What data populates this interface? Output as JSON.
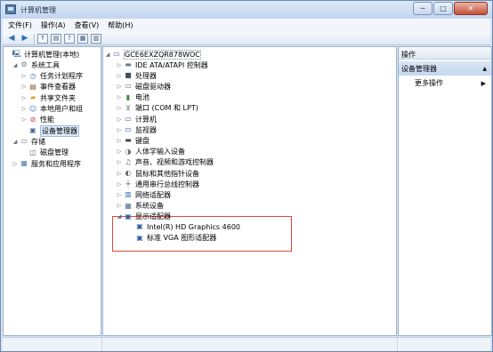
{
  "window": {
    "title": "计算机管理",
    "icon": "computer-management-icon",
    "caption_buttons": [
      "─",
      "□",
      "✕"
    ]
  },
  "menu": [
    "文件(F)",
    "操作(A)",
    "查看(V)",
    "帮助(H)"
  ],
  "toolbar": {
    "buttons": [
      "back-icon",
      "forward-icon",
      "up-folder-icon",
      "show-hide-tree-icon",
      "help-icon",
      "properties-icon",
      "view-icon"
    ]
  },
  "left_tree": [
    {
      "label": "计算机管理(本地)",
      "expander": "",
      "icon": "computer-management-icon"
    },
    {
      "label": "系统工具",
      "expander": "◢",
      "icon": "tools-icon"
    },
    {
      "label": "任务计划程序",
      "expander": "▷",
      "icon": "clock-icon"
    },
    {
      "label": "事件查看器",
      "expander": "▷",
      "icon": "event-viewer-icon"
    },
    {
      "label": "共享文件夹",
      "expander": "▷",
      "icon": "shared-folder-icon"
    },
    {
      "label": "本地用户和组",
      "expander": "▷",
      "icon": "users-icon"
    },
    {
      "label": "性能",
      "expander": "▷",
      "icon": "performance-icon"
    },
    {
      "label": "设备管理器",
      "expander": "",
      "icon": "device-manager-icon",
      "selected": true
    },
    {
      "label": "存储",
      "expander": "◢",
      "icon": "storage-icon"
    },
    {
      "label": "磁盘管理",
      "expander": "",
      "icon": "disk-icon"
    },
    {
      "label": "服务和应用程序",
      "expander": "▷",
      "icon": "services-icon"
    }
  ],
  "device_tree": {
    "root": "GCE6EXZQR878WOC",
    "items": [
      {
        "label": "IDE ATA/ATAPI 控制器",
        "expander": "▷",
        "icon": "ide-controller-icon"
      },
      {
        "label": "处理器",
        "expander": "▷",
        "icon": "processor-icon"
      },
      {
        "label": "磁盘驱动器",
        "expander": "▷",
        "icon": "disk-drive-icon"
      },
      {
        "label": "电池",
        "expander": "▷",
        "icon": "battery-icon"
      },
      {
        "label": "端口 (COM 和 LPT)",
        "expander": "▷",
        "icon": "port-icon"
      },
      {
        "label": "计算机",
        "expander": "▷",
        "icon": "computer-icon"
      },
      {
        "label": "监视器",
        "expander": "▷",
        "icon": "monitor-icon"
      },
      {
        "label": "键盘",
        "expander": "▷",
        "icon": "keyboard-icon"
      },
      {
        "label": "人体学输入设备",
        "expander": "▷",
        "icon": "hid-icon"
      },
      {
        "label": "声音、视频和游戏控制器",
        "expander": "▷",
        "icon": "sound-icon"
      },
      {
        "label": "鼠标和其他指针设备",
        "expander": "▷",
        "icon": "mouse-icon"
      },
      {
        "label": "通用串行总线控制器",
        "expander": "▷",
        "icon": "usb-icon"
      },
      {
        "label": "网络适配器",
        "expander": "▷",
        "icon": "network-adapter-icon"
      },
      {
        "label": "系统设备",
        "expander": "▷",
        "icon": "system-device-icon"
      },
      {
        "label": "显示适配器",
        "expander": "◢",
        "icon": "display-adapter-icon"
      }
    ],
    "display_children": [
      {
        "label": "Intel(R) HD Graphics 4600",
        "icon": "display-adapter-icon"
      },
      {
        "label": "标准 VGA 图形适配器",
        "icon": "display-adapter-icon"
      }
    ]
  },
  "actions": {
    "header": "操作",
    "group_title": "设备管理器",
    "group_collapse": "▲",
    "more": "更多操作",
    "more_arrow": "▶"
  },
  "colors": {
    "highlight_border": "#e04a3a",
    "selection": "#dde9f8"
  }
}
